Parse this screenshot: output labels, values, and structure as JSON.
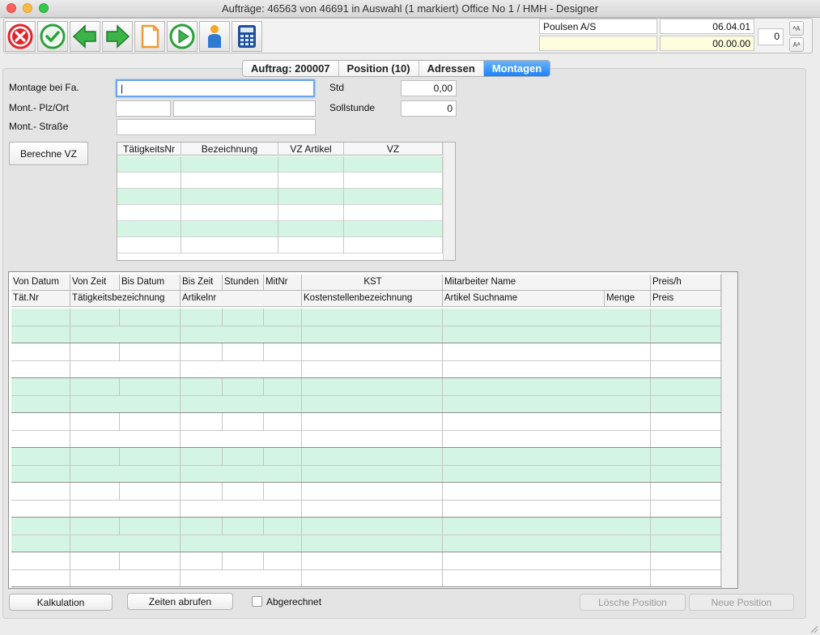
{
  "window": {
    "title": "Aufträge: 46563 von 46691 in Auswahl  (1 markiert) Office No 1 /  HMH - Designer"
  },
  "toolbar": {
    "buttons": [
      {
        "name": "cancel-icon",
        "color": "#e0262b"
      },
      {
        "name": "confirm-icon",
        "color": "#2aa13b"
      },
      {
        "name": "arrow-left-icon",
        "color": "#2aa13b"
      },
      {
        "name": "arrow-right-icon",
        "color": "#2aa13b"
      },
      {
        "name": "document-icon",
        "color": "#f29a2e"
      },
      {
        "name": "play-icon",
        "color": "#2aa13b"
      },
      {
        "name": "person-icon",
        "color": "#2c7bd1"
      },
      {
        "name": "calculator-icon",
        "color": "#1e4e9c"
      }
    ],
    "customer": "Poulsen A/S",
    "date": "06.04.01",
    "info_blank": "",
    "time": "00.00.00",
    "counter": "0",
    "font_up": "ᴬA",
    "font_down": "Aᴬ"
  },
  "tabs": [
    {
      "label": "Auftrag: 200007",
      "active": false
    },
    {
      "label": "Position (10)",
      "active": false
    },
    {
      "label": "Adressen",
      "active": false
    },
    {
      "label": "Montagen",
      "active": true
    }
  ],
  "form": {
    "montage_bei_label": "Montage bei Fa.",
    "montage_bei_value": "|",
    "plz_ort_label": "Mont.- Plz/Ort",
    "plz_value": "",
    "ort_value": "",
    "strasse_label": "Mont.- Straße",
    "strasse_value": "",
    "std_label": "Std",
    "std_value": "0,00",
    "sollstunde_label": "Sollstunde",
    "sollstunde_value": "0",
    "berechne_label": "Berechne VZ"
  },
  "vz_grid": {
    "headers": [
      "TätigkeitsNr",
      "Bezeichnung",
      "VZ Artikel",
      "VZ"
    ],
    "rows": 6
  },
  "main_grid": {
    "header_row1": [
      "Von Datum",
      "Von Zeit",
      "Bis Datum",
      "Bis Zeit",
      "Stunden",
      "MitNr",
      "KST",
      "Mitarbeiter Name",
      "Preis/h"
    ],
    "header_row2": [
      "Tät.Nr",
      "Tätigkeitsbezeichnung",
      "Artikelnr",
      "Kostenstellenbezeichnung",
      "Artikel Suchname",
      "Menge",
      "Preis"
    ],
    "records": 8
  },
  "footer": {
    "kalkulation": "Kalkulation",
    "zeiten_abrufen": "Zeiten abrufen",
    "abgerechnet": "Abgerechnet",
    "loesche_position": "Lösche Position",
    "neue_position": "Neue Position"
  }
}
